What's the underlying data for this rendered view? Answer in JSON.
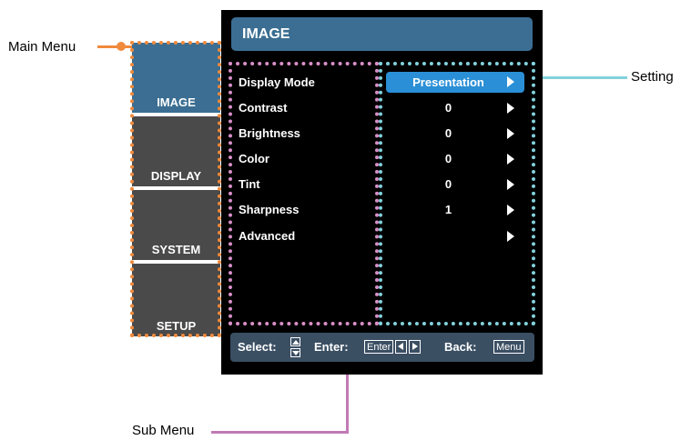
{
  "osd": {
    "title": "IMAGE",
    "tabs": [
      {
        "label": "IMAGE",
        "active": true
      },
      {
        "label": "DISPLAY",
        "active": false
      },
      {
        "label": "SYSTEM",
        "active": false
      },
      {
        "label": "SETUP",
        "active": false
      }
    ],
    "items": [
      {
        "label": "Display Mode",
        "value": "Presentation",
        "selected": true
      },
      {
        "label": "Contrast",
        "value": "0"
      },
      {
        "label": "Brightness",
        "value": "0"
      },
      {
        "label": "Color",
        "value": "0"
      },
      {
        "label": "Tint",
        "value": "0"
      },
      {
        "label": "Sharpness",
        "value": "1"
      },
      {
        "label": "Advanced",
        "value": ""
      }
    ],
    "footer": {
      "select": "Select:",
      "enter": "Enter:",
      "enter_key": "Enter",
      "back": "Back:",
      "menu_key": "Menu"
    }
  },
  "callouts": {
    "main_menu": "Main Menu",
    "sub_menu": "Sub Menu",
    "setting": "Setting"
  },
  "colors": {
    "main_menu_frame": "#f08a3c",
    "sub_menu_frame": "#d98fc8",
    "setting_frame": "#82d1dc",
    "header": "#3b6e92",
    "highlight": "#2a8fd6"
  }
}
